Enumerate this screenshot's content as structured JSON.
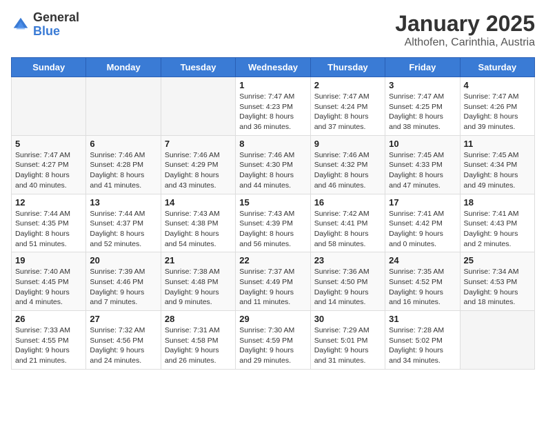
{
  "logo": {
    "general": "General",
    "blue": "Blue"
  },
  "header": {
    "month": "January 2025",
    "location": "Althofen, Carinthia, Austria"
  },
  "weekdays": [
    "Sunday",
    "Monday",
    "Tuesday",
    "Wednesday",
    "Thursday",
    "Friday",
    "Saturday"
  ],
  "weeks": [
    [
      {
        "day": "",
        "sunrise": "",
        "sunset": "",
        "daylight": ""
      },
      {
        "day": "",
        "sunrise": "",
        "sunset": "",
        "daylight": ""
      },
      {
        "day": "",
        "sunrise": "",
        "sunset": "",
        "daylight": ""
      },
      {
        "day": "1",
        "sunrise": "Sunrise: 7:47 AM",
        "sunset": "Sunset: 4:23 PM",
        "daylight": "Daylight: 8 hours and 36 minutes."
      },
      {
        "day": "2",
        "sunrise": "Sunrise: 7:47 AM",
        "sunset": "Sunset: 4:24 PM",
        "daylight": "Daylight: 8 hours and 37 minutes."
      },
      {
        "day": "3",
        "sunrise": "Sunrise: 7:47 AM",
        "sunset": "Sunset: 4:25 PM",
        "daylight": "Daylight: 8 hours and 38 minutes."
      },
      {
        "day": "4",
        "sunrise": "Sunrise: 7:47 AM",
        "sunset": "Sunset: 4:26 PM",
        "daylight": "Daylight: 8 hours and 39 minutes."
      }
    ],
    [
      {
        "day": "5",
        "sunrise": "Sunrise: 7:47 AM",
        "sunset": "Sunset: 4:27 PM",
        "daylight": "Daylight: 8 hours and 40 minutes."
      },
      {
        "day": "6",
        "sunrise": "Sunrise: 7:46 AM",
        "sunset": "Sunset: 4:28 PM",
        "daylight": "Daylight: 8 hours and 41 minutes."
      },
      {
        "day": "7",
        "sunrise": "Sunrise: 7:46 AM",
        "sunset": "Sunset: 4:29 PM",
        "daylight": "Daylight: 8 hours and 43 minutes."
      },
      {
        "day": "8",
        "sunrise": "Sunrise: 7:46 AM",
        "sunset": "Sunset: 4:30 PM",
        "daylight": "Daylight: 8 hours and 44 minutes."
      },
      {
        "day": "9",
        "sunrise": "Sunrise: 7:46 AM",
        "sunset": "Sunset: 4:32 PM",
        "daylight": "Daylight: 8 hours and 46 minutes."
      },
      {
        "day": "10",
        "sunrise": "Sunrise: 7:45 AM",
        "sunset": "Sunset: 4:33 PM",
        "daylight": "Daylight: 8 hours and 47 minutes."
      },
      {
        "day": "11",
        "sunrise": "Sunrise: 7:45 AM",
        "sunset": "Sunset: 4:34 PM",
        "daylight": "Daylight: 8 hours and 49 minutes."
      }
    ],
    [
      {
        "day": "12",
        "sunrise": "Sunrise: 7:44 AM",
        "sunset": "Sunset: 4:35 PM",
        "daylight": "Daylight: 8 hours and 51 minutes."
      },
      {
        "day": "13",
        "sunrise": "Sunrise: 7:44 AM",
        "sunset": "Sunset: 4:37 PM",
        "daylight": "Daylight: 8 hours and 52 minutes."
      },
      {
        "day": "14",
        "sunrise": "Sunrise: 7:43 AM",
        "sunset": "Sunset: 4:38 PM",
        "daylight": "Daylight: 8 hours and 54 minutes."
      },
      {
        "day": "15",
        "sunrise": "Sunrise: 7:43 AM",
        "sunset": "Sunset: 4:39 PM",
        "daylight": "Daylight: 8 hours and 56 minutes."
      },
      {
        "day": "16",
        "sunrise": "Sunrise: 7:42 AM",
        "sunset": "Sunset: 4:41 PM",
        "daylight": "Daylight: 8 hours and 58 minutes."
      },
      {
        "day": "17",
        "sunrise": "Sunrise: 7:41 AM",
        "sunset": "Sunset: 4:42 PM",
        "daylight": "Daylight: 9 hours and 0 minutes."
      },
      {
        "day": "18",
        "sunrise": "Sunrise: 7:41 AM",
        "sunset": "Sunset: 4:43 PM",
        "daylight": "Daylight: 9 hours and 2 minutes."
      }
    ],
    [
      {
        "day": "19",
        "sunrise": "Sunrise: 7:40 AM",
        "sunset": "Sunset: 4:45 PM",
        "daylight": "Daylight: 9 hours and 4 minutes."
      },
      {
        "day": "20",
        "sunrise": "Sunrise: 7:39 AM",
        "sunset": "Sunset: 4:46 PM",
        "daylight": "Daylight: 9 hours and 7 minutes."
      },
      {
        "day": "21",
        "sunrise": "Sunrise: 7:38 AM",
        "sunset": "Sunset: 4:48 PM",
        "daylight": "Daylight: 9 hours and 9 minutes."
      },
      {
        "day": "22",
        "sunrise": "Sunrise: 7:37 AM",
        "sunset": "Sunset: 4:49 PM",
        "daylight": "Daylight: 9 hours and 11 minutes."
      },
      {
        "day": "23",
        "sunrise": "Sunrise: 7:36 AM",
        "sunset": "Sunset: 4:50 PM",
        "daylight": "Daylight: 9 hours and 14 minutes."
      },
      {
        "day": "24",
        "sunrise": "Sunrise: 7:35 AM",
        "sunset": "Sunset: 4:52 PM",
        "daylight": "Daylight: 9 hours and 16 minutes."
      },
      {
        "day": "25",
        "sunrise": "Sunrise: 7:34 AM",
        "sunset": "Sunset: 4:53 PM",
        "daylight": "Daylight: 9 hours and 18 minutes."
      }
    ],
    [
      {
        "day": "26",
        "sunrise": "Sunrise: 7:33 AM",
        "sunset": "Sunset: 4:55 PM",
        "daylight": "Daylight: 9 hours and 21 minutes."
      },
      {
        "day": "27",
        "sunrise": "Sunrise: 7:32 AM",
        "sunset": "Sunset: 4:56 PM",
        "daylight": "Daylight: 9 hours and 24 minutes."
      },
      {
        "day": "28",
        "sunrise": "Sunrise: 7:31 AM",
        "sunset": "Sunset: 4:58 PM",
        "daylight": "Daylight: 9 hours and 26 minutes."
      },
      {
        "day": "29",
        "sunrise": "Sunrise: 7:30 AM",
        "sunset": "Sunset: 4:59 PM",
        "daylight": "Daylight: 9 hours and 29 minutes."
      },
      {
        "day": "30",
        "sunrise": "Sunrise: 7:29 AM",
        "sunset": "Sunset: 5:01 PM",
        "daylight": "Daylight: 9 hours and 31 minutes."
      },
      {
        "day": "31",
        "sunrise": "Sunrise: 7:28 AM",
        "sunset": "Sunset: 5:02 PM",
        "daylight": "Daylight: 9 hours and 34 minutes."
      },
      {
        "day": "",
        "sunrise": "",
        "sunset": "",
        "daylight": ""
      }
    ]
  ]
}
